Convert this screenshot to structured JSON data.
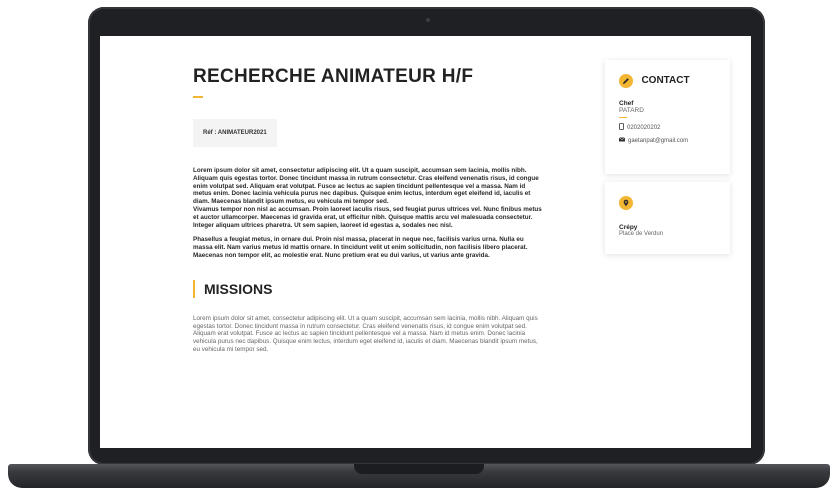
{
  "job": {
    "title": "RECHERCHE ANIMATEUR H/F",
    "reference": "Réf : ANIMATEUR2021",
    "paragraphs": [
      "Lorem ipsum dolor sit amet, consectetur adipiscing elit. Ut a quam suscipit, accumsan sem lacinia, mollis nibh. Aliquam quis egestas tortor. Donec tincidunt massa in rutrum consectetur. Cras eleifend venenatis risus, id congue enim volutpat sed. Aliquam erat volutpat. Fusce ac lectus ac sapien tincidunt pellentesque vel a massa. Nam id metus enim. Donec lacinia vehicula purus nec dapibus. Quisque enim lectus, interdum eget eleifend id, iaculis et diam. Maecenas blandit ipsum metus, eu vehicula mi tempor sed.",
      "Vivamus tempor non nisl ac accumsan. Proin laoreet iaculis risus, sed feugiat purus ultrices vel. Nunc finibus metus et auctor ullamcorper. Maecenas id gravida erat, ut efficitur nibh. Quisque mattis arcu vel malesuada consectetur. Integer aliquam ultrices pharetra. Ut sem sapien, laoreet id egestas a, sodales nec nisl.",
      "Phasellus a feugiat metus, in ornare dui. Proin nisl massa, placerat in neque nec, facilisis varius urna. Nulla eu massa elit. Nam varius metus id mattis ornare. In tincidunt velit ut enim sollicitudin, non facilisis libero placerat. Maecenas non tempor elit, ac molestie erat. Nunc pretium erat eu dui varius, ut varius ante gravida."
    ]
  },
  "missions": {
    "heading": "MISSIONS",
    "text": "Lorem ipsum dolor sit amet, consectetur adipiscing elit. Ut a quam suscipit, accumsan sem lacinia, mollis nibh. Aliquam quis egestas tortor. Donec tincidunt massa in rutrum consectetur. Cras eleifend venenatis risus, id congue enim volutpat sed. Aliquam erat volutpat. Fusce ac lectus ac sapien tincidunt pellentesque vel a massa. Nam id metus enim. Donec lacinia vehicula purus nec dapibus. Quisque enim lectus, interdum eget eleifend id, iaculis et diam. Maecenas blandit ipsum metus, eu vehicula mi tempor sed."
  },
  "contact": {
    "heading": "CONTACT",
    "role": "Chef",
    "name": "PATARD",
    "phone": "0202020202",
    "email": "gaetanpat@gmail.com",
    "icons": {
      "heading": "pencil-icon",
      "phone": "phone-icon",
      "email": "envelope-icon"
    }
  },
  "location": {
    "city": "Crépy",
    "street": "Place de Verdun",
    "icon": "map-pin-icon"
  },
  "colors": {
    "accent": "#f2b632",
    "frame": "#1f2023"
  }
}
